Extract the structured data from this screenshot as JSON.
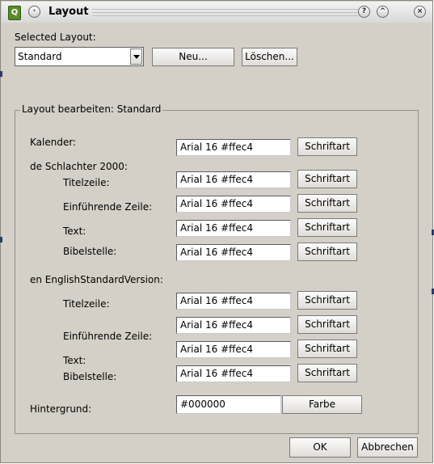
{
  "window": {
    "title": "Layout",
    "icon": "qt-icon",
    "buttons": [
      "menu-dot-icon",
      "help-icon",
      "shade-icon",
      "close-icon"
    ]
  },
  "selected_layout": {
    "label": "Selected Layout:",
    "value": "Standard",
    "new_button": "Neu...",
    "delete_button": "Löschen..."
  },
  "group": {
    "legend": "Layout bearbeiten: Standard"
  },
  "calendar": {
    "label": "Kalender:",
    "value": "Arial 16 #ffec4",
    "button": "Schriftart"
  },
  "schlachter": {
    "heading": "de Schlachter 2000:",
    "rows": [
      {
        "label": "Titelzeile:",
        "value": "Arial 16 #ffec4",
        "button": "Schriftart"
      },
      {
        "label": "Einführende Zeile:",
        "value": "Arial 16 #ffec4",
        "button": "Schriftart"
      },
      {
        "label": "Text:",
        "value": "Arial 16 #ffec4",
        "button": "Schriftart"
      },
      {
        "label": "Bibelstelle:",
        "value": "Arial 16 #ffec4",
        "button": "Schriftart"
      }
    ]
  },
  "esv": {
    "heading": "en EnglishStandardVersion:",
    "labels": [
      "Titelzeile:",
      "Einführende Zeile:",
      "Text:",
      "Bibelstelle:"
    ],
    "fields": [
      {
        "value": "Arial 16 #ffec4",
        "button": "Schriftart"
      },
      {
        "value": "Arial 16 #ffec4",
        "button": "Schriftart"
      },
      {
        "value": "Arial 16 #ffec4",
        "button": "Schriftart"
      },
      {
        "value": "Arial 16 #ffec4",
        "button": "Schriftart"
      }
    ]
  },
  "background": {
    "label": "Hintergrund:",
    "value": "#000000",
    "button": "Farbe"
  },
  "footer": {
    "ok": "OK",
    "cancel": "Abbrechen"
  },
  "colors": {
    "window_bg": "#d4d0c8",
    "title_bg": "#e6e6e6"
  }
}
